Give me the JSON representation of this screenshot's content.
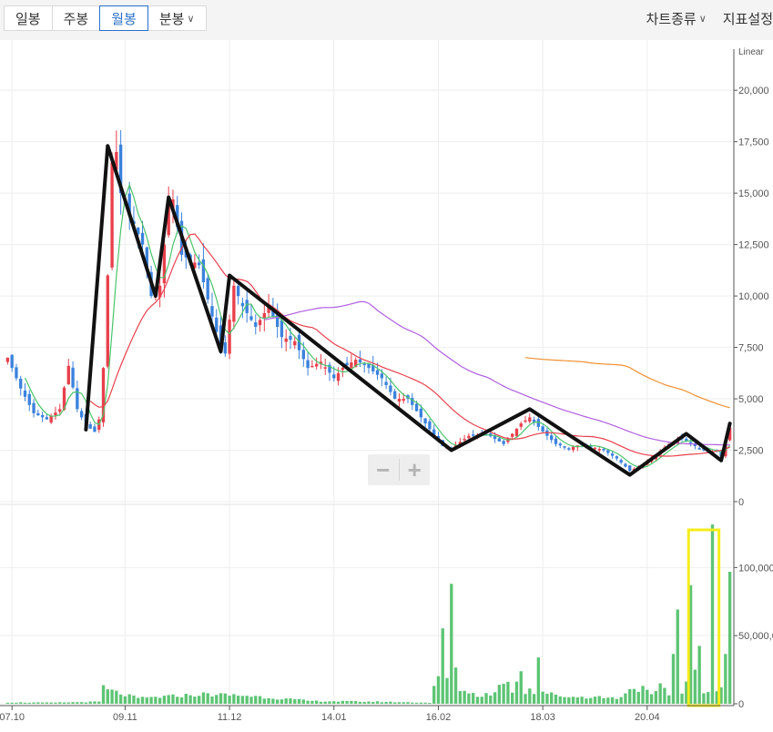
{
  "toolbar": {
    "periods": [
      {
        "label": "일봉",
        "active": false
      },
      {
        "label": "주봉",
        "active": false
      },
      {
        "label": "월봉",
        "active": true
      },
      {
        "label": "분봉",
        "active": false
      }
    ],
    "chart_type_label": "차트종류",
    "indicator_label": "지표설정"
  },
  "colors": {
    "up": "#e8404c",
    "down": "#3b82dd",
    "volume": "#5dc474",
    "ma5": "#4cc46a",
    "ma20": "#e8404c",
    "ma60": "#b05fe0",
    "ma120": "#f09030",
    "trend_line": "#111111",
    "highlight": "#f5ec1a",
    "axis_text": "#555555"
  },
  "chart_data": {
    "type": "candlestick",
    "scale_label": "Linear",
    "price_axis": {
      "min": 0,
      "max": 22000,
      "ticks": [
        0,
        2500,
        5000,
        7500,
        10000,
        12500,
        15000,
        17500,
        20000
      ],
      "tick_labels": [
        "0",
        "2,500",
        "5,000",
        "7,500",
        "10,000",
        "12,500",
        "15,000",
        "17,500",
        "20,000"
      ]
    },
    "volume_axis": {
      "min": 0,
      "max": 145000,
      "ticks": [
        0,
        50000,
        100000
      ],
      "tick_labels": [
        "0",
        "50,000,0",
        "100,000,"
      ]
    },
    "x_labels": [
      {
        "label": "07.10",
        "index": 1
      },
      {
        "label": "09.11",
        "index": 27
      },
      {
        "label": "11.12",
        "index": 51
      },
      {
        "label": "14.01",
        "index": 75
      },
      {
        "label": "16.02",
        "index": 99
      },
      {
        "label": "18.03",
        "index": 123
      },
      {
        "label": "20.04",
        "index": 147
      }
    ],
    "bar_count": 167,
    "close_anchors": [
      [
        0,
        7000
      ],
      [
        3,
        5500
      ],
      [
        6,
        4300
      ],
      [
        9,
        4000
      ],
      [
        12,
        4500
      ],
      [
        14,
        6600
      ],
      [
        16,
        4500
      ],
      [
        18,
        3700
      ],
      [
        20,
        3400
      ],
      [
        21,
        4000
      ],
      [
        22,
        6500
      ],
      [
        23,
        11000
      ],
      [
        24,
        16500
      ],
      [
        25,
        17000
      ],
      [
        26,
        15000
      ],
      [
        28,
        14000
      ],
      [
        31,
        12500
      ],
      [
        33,
        10000
      ],
      [
        35,
        10500
      ],
      [
        37,
        14500
      ],
      [
        38,
        14700
      ],
      [
        40,
        12000
      ],
      [
        44,
        11500
      ],
      [
        47,
        9000
      ],
      [
        49,
        7500
      ],
      [
        50,
        7200
      ],
      [
        52,
        10500
      ],
      [
        54,
        9500
      ],
      [
        57,
        8500
      ],
      [
        60,
        9500
      ],
      [
        63,
        8000
      ],
      [
        66,
        7800
      ],
      [
        69,
        6500
      ],
      [
        72,
        6800
      ],
      [
        75,
        6000
      ],
      [
        77,
        6500
      ],
      [
        80,
        6900
      ],
      [
        83,
        6500
      ],
      [
        86,
        6000
      ],
      [
        89,
        5000
      ],
      [
        92,
        5000
      ],
      [
        96,
        3800
      ],
      [
        100,
        2700
      ],
      [
        102,
        2600
      ],
      [
        106,
        3200
      ],
      [
        110,
        3300
      ],
      [
        114,
        2800
      ],
      [
        118,
        3800
      ],
      [
        120,
        4100
      ],
      [
        123,
        3400
      ],
      [
        126,
        2800
      ],
      [
        129,
        2600
      ],
      [
        132,
        2800
      ],
      [
        137,
        2500
      ],
      [
        140,
        2100
      ],
      [
        143,
        1500
      ],
      [
        146,
        1800
      ],
      [
        149,
        2300
      ],
      [
        152,
        2800
      ],
      [
        155,
        3100
      ],
      [
        158,
        2700
      ],
      [
        161,
        2400
      ],
      [
        163,
        2500
      ],
      [
        164,
        2200
      ],
      [
        166,
        3600
      ]
    ],
    "volume_anchors": [
      [
        0,
        1000
      ],
      [
        10,
        800
      ],
      [
        21,
        1500
      ],
      [
        22,
        12000
      ],
      [
        23,
        10000
      ],
      [
        30,
        4000
      ],
      [
        45,
        7000
      ],
      [
        55,
        6000
      ],
      [
        70,
        2000
      ],
      [
        85,
        1500
      ],
      [
        97,
        800
      ],
      [
        98,
        12000
      ],
      [
        99,
        17000
      ],
      [
        100,
        52000
      ],
      [
        101,
        19000
      ],
      [
        102,
        86000
      ],
      [
        103,
        22000
      ],
      [
        104,
        11000
      ],
      [
        108,
        6000
      ],
      [
        112,
        8000
      ],
      [
        114,
        18000
      ],
      [
        116,
        10000
      ],
      [
        118,
        26000
      ],
      [
        119,
        8000
      ],
      [
        120,
        14000
      ],
      [
        121,
        7000
      ],
      [
        122,
        38000
      ],
      [
        123,
        9000
      ],
      [
        126,
        6000
      ],
      [
        130,
        5000
      ],
      [
        136,
        5000
      ],
      [
        140,
        4000
      ],
      [
        144,
        12000
      ],
      [
        146,
        11000
      ],
      [
        148,
        6000
      ],
      [
        150,
        12000
      ],
      [
        152,
        7000
      ],
      [
        154,
        66000
      ],
      [
        155,
        8000
      ],
      [
        156,
        21000
      ],
      [
        157,
        75000
      ],
      [
        158,
        30000
      ],
      [
        159,
        36000
      ],
      [
        160,
        8000
      ],
      [
        161,
        7000
      ],
      [
        162,
        124000
      ],
      [
        163,
        9000
      ],
      [
        164,
        16000
      ],
      [
        165,
        46000
      ],
      [
        166,
        95000
      ]
    ],
    "series": [
      {
        "name": "MA5",
        "period": 5
      },
      {
        "name": "MA20",
        "period": 20
      },
      {
        "name": "MA60",
        "period": 60
      },
      {
        "name": "MA120",
        "period": 120
      }
    ],
    "trend_line": [
      [
        18,
        3500
      ],
      [
        23,
        17300
      ],
      [
        34,
        10000
      ],
      [
        37,
        14800
      ],
      [
        49,
        7300
      ],
      [
        51,
        11000
      ],
      [
        102,
        2500
      ],
      [
        120,
        4500
      ],
      [
        143,
        1300
      ],
      [
        156,
        3300
      ],
      [
        164,
        2000
      ],
      [
        166,
        3800
      ]
    ],
    "volume_highlight_range": [
      157,
      163
    ],
    "grid": true
  }
}
